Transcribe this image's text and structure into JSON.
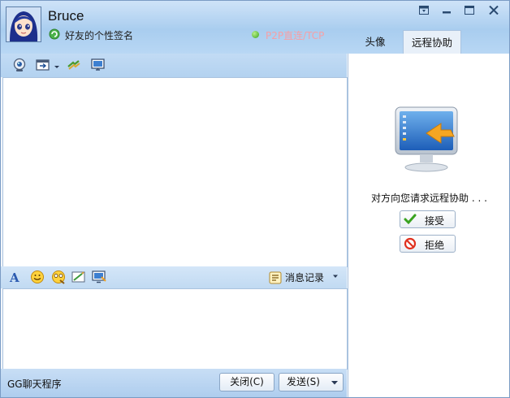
{
  "user": {
    "name": "Bruce",
    "signature": "好友的个性签名",
    "connection": "P2P直连/TCP",
    "status_color": "#3aa320"
  },
  "tabs": [
    {
      "label": "头像",
      "active": false
    },
    {
      "label": "远程协助",
      "active": true
    }
  ],
  "window_controls": [
    "skin-icon",
    "minimize-icon",
    "maximize-icon",
    "close-icon"
  ],
  "toolbar": {
    "icons": [
      "video-call-icon",
      "send-file-icon",
      "dropdown-arrow-icon",
      "shake-icon",
      "remote-desktop-icon"
    ]
  },
  "format_bar": {
    "icons": [
      "font-icon",
      "emoticon-icon",
      "snapshot-icon",
      "handwriting-icon",
      "screen-capture-icon"
    ],
    "history_label": "消息记录"
  },
  "bottom": {
    "app_name": "GG聊天程序",
    "close_label": "关闭(C)",
    "send_label": "发送(S)"
  },
  "remote_panel": {
    "request_text": "对方向您请求远程协助 . . .",
    "accept_label": "接受",
    "reject_label": "拒绝"
  },
  "colors": {
    "header_blue": "#a9cdef",
    "border": "#7a9bc4",
    "accent": "#3aa320"
  }
}
